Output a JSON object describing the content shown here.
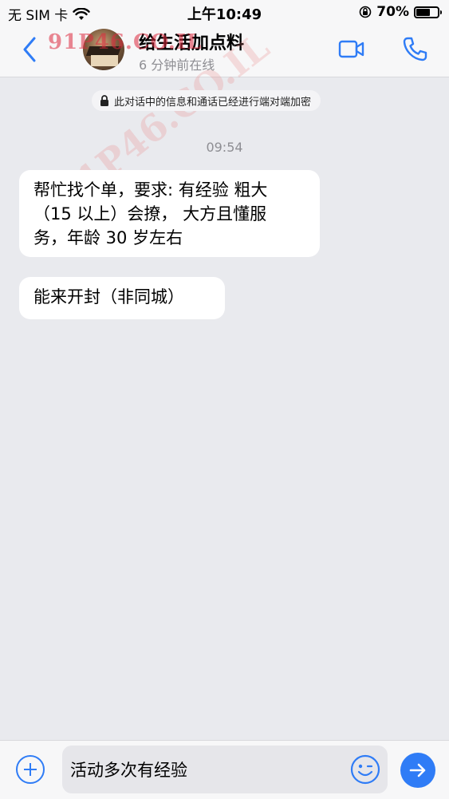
{
  "status_bar": {
    "carrier": "无 SIM 卡",
    "time": "上午10:49",
    "battery": "70%",
    "battery_level": 0.7
  },
  "header": {
    "watermark": "91P46.CO.IL",
    "contact_name": "给生活加点料",
    "last_seen": "6 分钟前在线"
  },
  "chat": {
    "encryption_notice": "此对话中的信息和通话已经进行端对端加密",
    "time_separator": "09:54",
    "messages": [
      {
        "lines": [
          "帮忙找个单，要求: 有经验 粗大",
          "（15 以上）会撩， 大方且懂服",
          "务，年龄 30 岁左右"
        ]
      },
      {
        "lines": [
          "能来开封（非同城）"
        ]
      }
    ]
  },
  "input": {
    "value": "活动多次有经验"
  },
  "colors": {
    "accent": "#2f7cf6",
    "background": "#e9eaee"
  }
}
